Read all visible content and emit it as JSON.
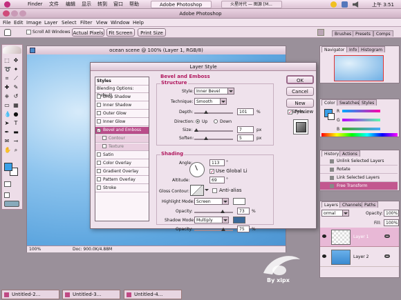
{
  "os_menubar": {
    "apple": "",
    "items": [
      "Finder",
      "文件",
      "编辑",
      "显示",
      "转到",
      "窗口",
      "帮助"
    ],
    "app_tab": "Adobe Photoshop",
    "other_tab": "火星时代 — 图源 [M...",
    "clock": "上午 3:51"
  },
  "app_title": "Adobe Photoshop",
  "menubar": {
    "items": [
      "File",
      "Edit",
      "Image",
      "Layer",
      "Select",
      "Filter",
      "View",
      "Window",
      "Help"
    ]
  },
  "options_bar": {
    "scroll_all": "Scroll All Windows",
    "actual_pixels": "Actual Pixels",
    "fit_screen": "Fit Screen",
    "print_size": "Print Size"
  },
  "palette_well": {
    "tabs": [
      "Brushes",
      "Presets",
      "Comps"
    ]
  },
  "document": {
    "title": "ocean scene @ 100% (Layer 1, RGB/8)",
    "zoom": "100%",
    "doc_info": "Doc: 900.0K/4.88M"
  },
  "dialog": {
    "title": "Layer Style",
    "styles_header": "Styles",
    "blending": "Blending Options: Default",
    "effects": [
      "Drop Shadow",
      "Inner Shadow",
      "Outer Glow",
      "Inner Glow",
      "Bevel and Emboss",
      "Contour",
      "Texture",
      "Satin",
      "Color Overlay",
      "Gradient Overlay",
      "Pattern Overlay",
      "Stroke"
    ],
    "section_title": "Bevel and Emboss",
    "structure": "Structure",
    "style_label": "Style:",
    "style_value": "Inner Bevel",
    "technique_label": "Technique:",
    "technique_value": "Smooth",
    "depth_label": "Depth:",
    "depth_value": "101",
    "depth_unit": "%",
    "depth_level": 0.3,
    "direction_label": "Direction:",
    "dir_up": "Up",
    "dir_down": "Down",
    "size_label": "Size:",
    "size_value": "7",
    "size_unit": "px",
    "size_level": 0.05,
    "soften_label": "Soften:",
    "soften_value": "5",
    "soften_unit": "px",
    "soften_level": 0.3,
    "shading": "Shading",
    "angle_label": "Angle:",
    "angle_value": "113",
    "angle_unit": "°",
    "global_light": "Use Global Li",
    "altitude_label": "Altitude:",
    "altitude_value": "69",
    "altitude_unit": "°",
    "gloss_label": "Gloss Contour:",
    "anti_aliased": "Anti-alias",
    "highlight_label": "Highlight Mode:",
    "highlight_value": "Screen",
    "highlight_color": "#ffffff",
    "hl_opacity_label": "Opacity:",
    "hl_opacity_value": "73",
    "hl_opacity_unit": "%",
    "hl_opacity_level": 0.73,
    "shadow_label": "Shadow Mode:",
    "shadow_value": "Multiply",
    "shadow_color": "#3a6a9a",
    "sh_opacity_label": "Opacity:",
    "sh_opacity_value": "75",
    "sh_opacity_unit": "%",
    "sh_opacity_level": 0.75,
    "ok": "OK",
    "cancel": "Cancel",
    "new_style": "New Style...",
    "preview": "Preview"
  },
  "navigator": {
    "tabs": [
      "Navigator",
      "Info",
      "Histogram"
    ]
  },
  "color_palette": {
    "tabs": [
      "Color",
      "Swatches",
      "Styles"
    ],
    "r": "R",
    "g": "G",
    "b": "B"
  },
  "history": {
    "tabs": [
      "History",
      "Actions"
    ],
    "items": [
      "Unlink Selected Layers",
      "Rotate",
      "Link Selected Layers",
      "Free Transform"
    ]
  },
  "layers": {
    "tabs": [
      "Layers",
      "Channels",
      "Paths"
    ],
    "mode": "ormal",
    "opacity_label": "Opacity:",
    "opacity_value": "100%",
    "fill_label": "Fill:",
    "fill_value": "100%",
    "items": [
      "Layer 1",
      "Layer 2"
    ]
  },
  "taskbar": {
    "docs": [
      "Untitled-2...",
      "Untitled-3...",
      "Untitled-4..."
    ]
  },
  "watermark": {
    "text": "By xipx"
  },
  "colors": {
    "accent": "#b0185e",
    "pink": "#e9c7dd",
    "ocean": "#7fb8e6"
  }
}
